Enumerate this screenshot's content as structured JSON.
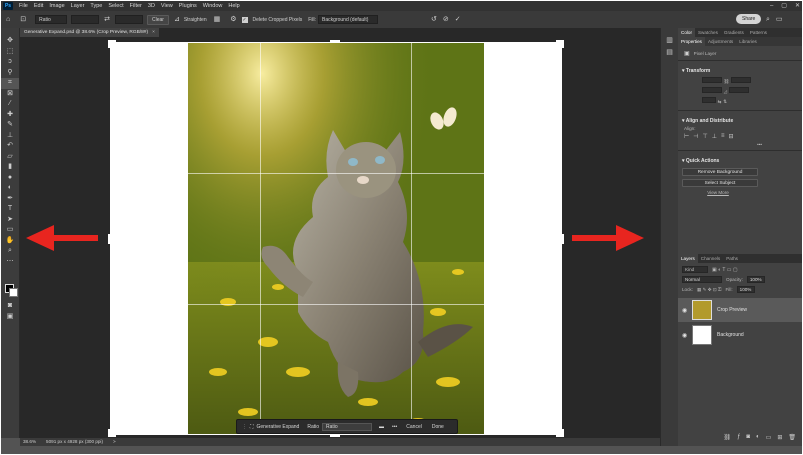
{
  "app": {
    "menu": [
      "File",
      "Edit",
      "Image",
      "Layer",
      "Type",
      "Select",
      "Filter",
      "3D",
      "View",
      "Plugins",
      "Window",
      "Help"
    ],
    "logo_text": "Ps"
  },
  "options_bar": {
    "ratio_select": "Ratio",
    "clear_label": "Clear",
    "straighten_label": "Straighten",
    "delete_cropped_label": "Delete Cropped Pixels",
    "fill_label": "Fill:",
    "fill_select": "Background (default)",
    "share_label": "Share"
  },
  "document_tab": {
    "title": "Generative Expand.psd @ 38.6% (Crop Preview, RGB/8#)",
    "close": "×"
  },
  "status_bar": {
    "zoom": "38.6%",
    "doc_size": "5091 px x 4928 px (300 ppi)",
    "nav": ">"
  },
  "taskbar": {
    "generative_expand_label": "Generative Expand",
    "ratio_label": "Ratio",
    "ratio_select": "Ratio",
    "more": "•••",
    "cancel_label": "Cancel",
    "done_label": "Done"
  },
  "top_panel": {
    "tabs": [
      "Color",
      "Swatches",
      "Gradients",
      "Patterns"
    ],
    "sub_tabs": [
      "Properties",
      "Adjustments",
      "Libraries"
    ],
    "pixel_layer": "Pixel Layer",
    "transform_heading": "Transform",
    "align_heading": "Align and Distribute",
    "align_label": "Align:",
    "more": "•••",
    "quick_actions_heading": "Quick Actions",
    "remove_bg_label": "Remove Background",
    "select_subject_label": "Select Subject",
    "view_more_label": "View More"
  },
  "layers_panel": {
    "tabs": [
      "Layers",
      "Channels",
      "Paths"
    ],
    "kind_label": "Kind",
    "blend_mode": "Normal",
    "opacity_label": "Opacity:",
    "opacity_value": "100%",
    "lock_label": "Lock:",
    "fill_label": "Fill:",
    "fill_value": "100%",
    "layers": [
      {
        "name": "Crop Preview"
      },
      {
        "name": "Background"
      }
    ]
  },
  "colors": {
    "arrow": "#e8251f",
    "canvas_bg": "#282828",
    "ui_bg": "#535353"
  }
}
